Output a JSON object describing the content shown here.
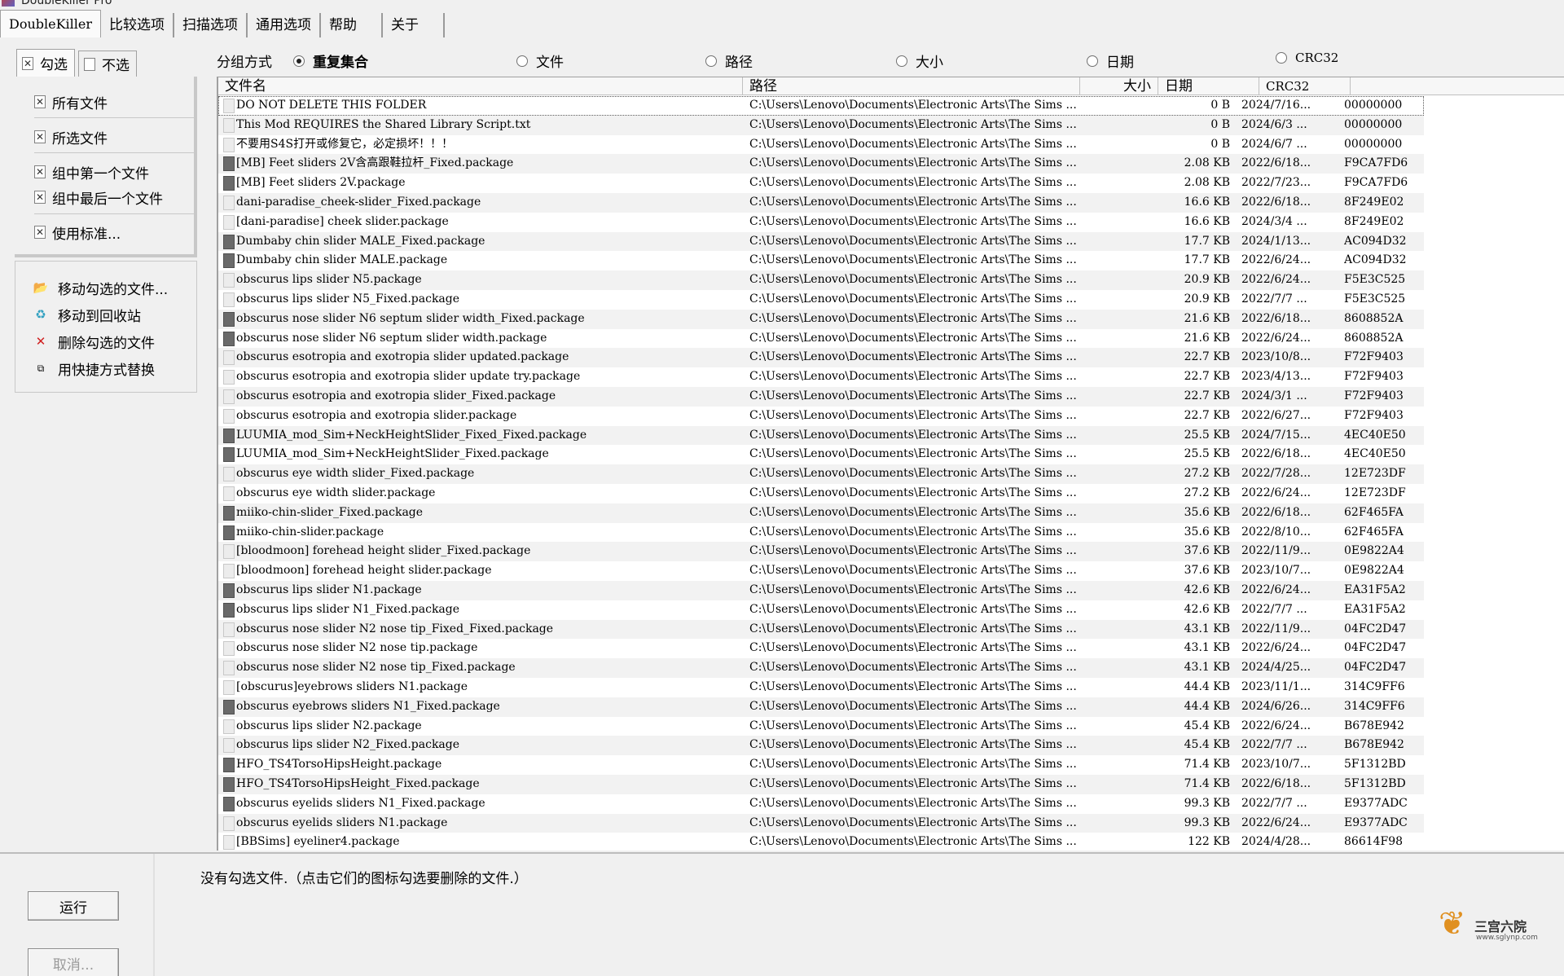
{
  "window": {
    "title": "DoubleKiller Pro"
  },
  "main_tabs": [
    "DoubleKiller",
    "比较选项",
    "扫描选项",
    "通用选项",
    "帮助",
    "关于"
  ],
  "sub_tabs": {
    "check": "勾选",
    "uncheck": "不选"
  },
  "select_items": [
    "所有文件",
    "所选文件",
    "组中第一个文件",
    "组中最后一个文件",
    "使用标准..."
  ],
  "actions": [
    "移动勾选的文件...",
    "移动到回收站",
    "删除勾选的文件",
    "用快捷方式替换"
  ],
  "group_by": {
    "label": "分组方式",
    "options": [
      "重复集合",
      "文件",
      "路径",
      "大小",
      "日期",
      "CRC32"
    ],
    "selected": "重复集合"
  },
  "table": {
    "headers": {
      "name": "文件名",
      "path": "路径",
      "size": "大小",
      "date": "日期",
      "crc": "CRC32"
    },
    "rows": [
      {
        "name": "DO NOT DELETE THIS FOLDER",
        "path": "C:\\Users\\Lenovo\\Documents\\Electronic Arts\\The Sims ...",
        "size": "0 B",
        "date": "2024/7/16...",
        "crc": "00000000"
      },
      {
        "name": "This Mod REQUIRES the Shared Library Script.txt",
        "path": "C:\\Users\\Lenovo\\Documents\\Electronic Arts\\The Sims ...",
        "size": "0 B",
        "date": "2024/6/3 ...",
        "crc": "00000000"
      },
      {
        "name": "不要用S4S打开或修复它，必定损坏！！！",
        "path": "C:\\Users\\Lenovo\\Documents\\Electronic Arts\\The Sims ...",
        "size": "0 B",
        "date": "2024/6/7 ...",
        "crc": "00000000"
      },
      {
        "name": "[MB] Feet sliders 2V含高跟鞋拉杆_Fixed.package",
        "path": "C:\\Users\\Lenovo\\Documents\\Electronic Arts\\The Sims ...",
        "size": "2.08 KB",
        "date": "2022/6/18...",
        "crc": "F9CA7FD6"
      },
      {
        "name": "[MB] Feet sliders 2V.package",
        "path": "C:\\Users\\Lenovo\\Documents\\Electronic Arts\\The Sims ...",
        "size": "2.08 KB",
        "date": "2022/7/23...",
        "crc": "F9CA7FD6"
      },
      {
        "name": "dani-paradise_cheek-slider_Fixed.package",
        "path": "C:\\Users\\Lenovo\\Documents\\Electronic Arts\\The Sims ...",
        "size": "16.6 KB",
        "date": "2022/6/18...",
        "crc": "8F249E02"
      },
      {
        "name": "[dani-paradise] cheek slider.package",
        "path": "C:\\Users\\Lenovo\\Documents\\Electronic Arts\\The Sims ...",
        "size": "16.6 KB",
        "date": "2024/3/4 ...",
        "crc": "8F249E02"
      },
      {
        "name": "Dumbaby chin slider MALE_Fixed.package",
        "path": "C:\\Users\\Lenovo\\Documents\\Electronic Arts\\The Sims ...",
        "size": "17.7 KB",
        "date": "2024/1/13...",
        "crc": "AC094D32"
      },
      {
        "name": "Dumbaby chin slider MALE.package",
        "path": "C:\\Users\\Lenovo\\Documents\\Electronic Arts\\The Sims ...",
        "size": "17.7 KB",
        "date": "2022/6/24...",
        "crc": "AC094D32"
      },
      {
        "name": "obscurus lips slider N5.package",
        "path": "C:\\Users\\Lenovo\\Documents\\Electronic Arts\\The Sims ...",
        "size": "20.9 KB",
        "date": "2022/6/24...",
        "crc": "F5E3C525"
      },
      {
        "name": "obscurus lips slider N5_Fixed.package",
        "path": "C:\\Users\\Lenovo\\Documents\\Electronic Arts\\The Sims ...",
        "size": "20.9 KB",
        "date": "2022/7/7 ...",
        "crc": "F5E3C525"
      },
      {
        "name": "obscurus nose slider N6 septum slider width_Fixed.package",
        "path": "C:\\Users\\Lenovo\\Documents\\Electronic Arts\\The Sims ...",
        "size": "21.6 KB",
        "date": "2022/6/18...",
        "crc": "8608852A"
      },
      {
        "name": "obscurus nose slider N6 septum slider width.package",
        "path": "C:\\Users\\Lenovo\\Documents\\Electronic Arts\\The Sims ...",
        "size": "21.6 KB",
        "date": "2022/6/24...",
        "crc": "8608852A"
      },
      {
        "name": "obscurus esotropia and exotropia slider updated.package",
        "path": "C:\\Users\\Lenovo\\Documents\\Electronic Arts\\The Sims ...",
        "size": "22.7 KB",
        "date": "2023/10/8...",
        "crc": "F72F9403"
      },
      {
        "name": "obscurus esotropia and exotropia slider update try.package",
        "path": "C:\\Users\\Lenovo\\Documents\\Electronic Arts\\The Sims ...",
        "size": "22.7 KB",
        "date": "2023/4/13...",
        "crc": "F72F9403"
      },
      {
        "name": "obscurus esotropia and exotropia slider_Fixed.package",
        "path": "C:\\Users\\Lenovo\\Documents\\Electronic Arts\\The Sims ...",
        "size": "22.7 KB",
        "date": "2024/3/1 ...",
        "crc": "F72F9403"
      },
      {
        "name": "obscurus esotropia and exotropia slider.package",
        "path": "C:\\Users\\Lenovo\\Documents\\Electronic Arts\\The Sims ...",
        "size": "22.7 KB",
        "date": "2022/6/27...",
        "crc": "F72F9403"
      },
      {
        "name": "LUUMIA_mod_Sim+NeckHeightSlider_Fixed_Fixed.package",
        "path": "C:\\Users\\Lenovo\\Documents\\Electronic Arts\\The Sims ...",
        "size": "25.5 KB",
        "date": "2024/7/15...",
        "crc": "4EC40E50"
      },
      {
        "name": "LUUMIA_mod_Sim+NeckHeightSlider_Fixed.package",
        "path": "C:\\Users\\Lenovo\\Documents\\Electronic Arts\\The Sims ...",
        "size": "25.5 KB",
        "date": "2022/6/18...",
        "crc": "4EC40E50"
      },
      {
        "name": "obscurus eye width slider_Fixed.package",
        "path": "C:\\Users\\Lenovo\\Documents\\Electronic Arts\\The Sims ...",
        "size": "27.2 KB",
        "date": "2022/7/28...",
        "crc": "12E723DF"
      },
      {
        "name": "obscurus eye width slider.package",
        "path": "C:\\Users\\Lenovo\\Documents\\Electronic Arts\\The Sims ...",
        "size": "27.2 KB",
        "date": "2022/6/24...",
        "crc": "12E723DF"
      },
      {
        "name": "miiko-chin-slider_Fixed.package",
        "path": "C:\\Users\\Lenovo\\Documents\\Electronic Arts\\The Sims ...",
        "size": "35.6 KB",
        "date": "2022/6/18...",
        "crc": "62F465FA"
      },
      {
        "name": "miiko-chin-slider.package",
        "path": "C:\\Users\\Lenovo\\Documents\\Electronic Arts\\The Sims ...",
        "size": "35.6 KB",
        "date": "2022/8/10...",
        "crc": "62F465FA"
      },
      {
        "name": "[bloodmoon] forehead height slider_Fixed.package",
        "path": "C:\\Users\\Lenovo\\Documents\\Electronic Arts\\The Sims ...",
        "size": "37.6 KB",
        "date": "2022/11/9...",
        "crc": "0E9822A4"
      },
      {
        "name": "[bloodmoon] forehead height slider.package",
        "path": "C:\\Users\\Lenovo\\Documents\\Electronic Arts\\The Sims ...",
        "size": "37.6 KB",
        "date": "2023/10/7...",
        "crc": "0E9822A4"
      },
      {
        "name": "obscurus lips slider N1.package",
        "path": "C:\\Users\\Lenovo\\Documents\\Electronic Arts\\The Sims ...",
        "size": "42.6 KB",
        "date": "2022/6/24...",
        "crc": "EA31F5A2"
      },
      {
        "name": "obscurus lips slider N1_Fixed.package",
        "path": "C:\\Users\\Lenovo\\Documents\\Electronic Arts\\The Sims ...",
        "size": "42.6 KB",
        "date": "2022/7/7 ...",
        "crc": "EA31F5A2"
      },
      {
        "name": "obscurus nose slider N2 nose tip_Fixed_Fixed.package",
        "path": "C:\\Users\\Lenovo\\Documents\\Electronic Arts\\The Sims ...",
        "size": "43.1 KB",
        "date": "2022/11/9...",
        "crc": "04FC2D47"
      },
      {
        "name": "obscurus nose slider N2 nose tip.package",
        "path": "C:\\Users\\Lenovo\\Documents\\Electronic Arts\\The Sims ...",
        "size": "43.1 KB",
        "date": "2022/6/24...",
        "crc": "04FC2D47"
      },
      {
        "name": "obscurus nose slider N2 nose tip_Fixed.package",
        "path": "C:\\Users\\Lenovo\\Documents\\Electronic Arts\\The Sims ...",
        "size": "43.1 KB",
        "date": "2024/4/25...",
        "crc": "04FC2D47"
      },
      {
        "name": "[obscurus]eyebrows sliders N1.package",
        "path": "C:\\Users\\Lenovo\\Documents\\Electronic Arts\\The Sims ...",
        "size": "44.4 KB",
        "date": "2023/11/1...",
        "crc": "314C9FF6"
      },
      {
        "name": "obscurus eyebrows sliders N1_Fixed.package",
        "path": "C:\\Users\\Lenovo\\Documents\\Electronic Arts\\The Sims ...",
        "size": "44.4 KB",
        "date": "2024/6/26...",
        "crc": "314C9FF6"
      },
      {
        "name": "obscurus lips slider N2.package",
        "path": "C:\\Users\\Lenovo\\Documents\\Electronic Arts\\The Sims ...",
        "size": "45.4 KB",
        "date": "2022/6/24...",
        "crc": "B678E942"
      },
      {
        "name": "obscurus lips slider N2_Fixed.package",
        "path": "C:\\Users\\Lenovo\\Documents\\Electronic Arts\\The Sims ...",
        "size": "45.4 KB",
        "date": "2022/7/7 ...",
        "crc": "B678E942"
      },
      {
        "name": "HFO_TS4TorsoHipsHeight.package",
        "path": "C:\\Users\\Lenovo\\Documents\\Electronic Arts\\The Sims ...",
        "size": "71.4 KB",
        "date": "2023/10/7...",
        "crc": "5F1312BD"
      },
      {
        "name": "HFO_TS4TorsoHipsHeight_Fixed.package",
        "path": "C:\\Users\\Lenovo\\Documents\\Electronic Arts\\The Sims ...",
        "size": "71.4 KB",
        "date": "2022/6/18...",
        "crc": "5F1312BD"
      },
      {
        "name": "obscurus eyelids sliders N1_Fixed.package",
        "path": "C:\\Users\\Lenovo\\Documents\\Electronic Arts\\The Sims ...",
        "size": "99.3 KB",
        "date": "2022/7/7 ...",
        "crc": "E9377ADC"
      },
      {
        "name": "obscurus eyelids sliders N1.package",
        "path": "C:\\Users\\Lenovo\\Documents\\Electronic Arts\\The Sims ...",
        "size": "99.3 KB",
        "date": "2022/6/24...",
        "crc": "E9377ADC"
      },
      {
        "name": "[BBSims] eyeliner4.package",
        "path": "C:\\Users\\Lenovo\\Documents\\Electronic Arts\\The Sims ...",
        "size": "122 KB",
        "date": "2024/4/28...",
        "crc": "86614F98"
      }
    ]
  },
  "status": {
    "message": "没有勾选文件.（点击它们的图标勾选要删除的文件.）"
  },
  "buttons": {
    "run": "运行",
    "cancel": "取消..."
  },
  "logo": {
    "text": "三宫六院",
    "url": "www.sglynp.com"
  },
  "colors": {
    "row_alt": "#f2f2f2",
    "icon_dark": "#6a6a6a"
  }
}
